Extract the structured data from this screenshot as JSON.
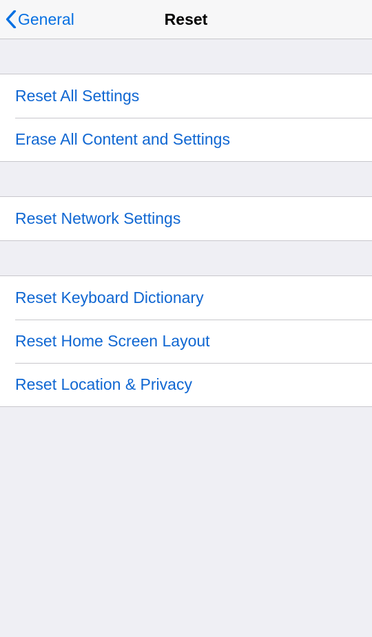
{
  "nav": {
    "back_label": "General",
    "title": "Reset"
  },
  "groups": [
    {
      "items": [
        {
          "label": "Reset All Settings"
        },
        {
          "label": "Erase All Content and Settings"
        }
      ]
    },
    {
      "items": [
        {
          "label": "Reset Network Settings"
        }
      ]
    },
    {
      "items": [
        {
          "label": "Reset Keyboard Dictionary"
        },
        {
          "label": "Reset Home Screen Layout"
        },
        {
          "label": "Reset Location & Privacy"
        }
      ]
    }
  ]
}
